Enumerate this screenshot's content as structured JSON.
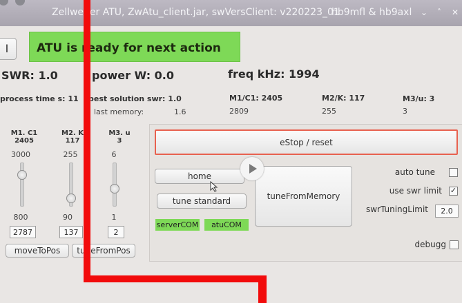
{
  "window": {
    "title": "Zellweger ATU, ZwAtu_client.jar,  swVersClient: v220223_01",
    "user": "hb9mfl & hb9axl",
    "controls": [
      "⌄",
      "˄",
      "✕"
    ]
  },
  "status_button": "I",
  "status_message": "ATU is ready for next action",
  "readouts": {
    "swr": "SWR: 1.0",
    "power": "power W: 0.0",
    "freq": "freq kHz: 1994"
  },
  "info": {
    "process_time": "process time s: 11",
    "best_solution": "best solution swr: 1.0",
    "m1c1": "M1/C1: 2405",
    "m2k": "M2/K: 117",
    "m3u": "M3/u: 3",
    "last_memory_label": "last memory:",
    "last_memory_swr": "1.6",
    "last_memory_m1": "2809",
    "last_memory_m2": "255",
    "last_memory_m3": "3"
  },
  "sliders": [
    {
      "label1": "M1. C1",
      "label2": "2405",
      "max": "3000",
      "min": "800",
      "input": "2787",
      "level": 0.73
    },
    {
      "label1": "M2. K",
      "label2": "117",
      "max": "255",
      "min": "90",
      "input": "137",
      "level": 0.17
    },
    {
      "label1": "M3. u",
      "label2": "3",
      "max": "6",
      "min": "1",
      "input": "2",
      "level": 0.4
    }
  ],
  "buttons": {
    "move_to_pos": "moveToPos",
    "tune_from_pos": "tuneFromPos",
    "estop": "eStop / reset",
    "home": "home",
    "tune_standard": "tune standard",
    "tune_from_memory": "tuneFromMemory"
  },
  "indicators": {
    "server_com": "serverCOM",
    "atu_com": "atuCOM"
  },
  "options": {
    "auto_tune": {
      "label": "auto tune",
      "checked": false
    },
    "use_swr_limit": {
      "label": "use swr limit",
      "checked": true
    },
    "swr_tuning_limit_label": "swrTuningLimit",
    "swr_tuning_limit_value": "2.0",
    "debugg": {
      "label": "debugg",
      "checked": false
    }
  },
  "colors": {
    "status_green": "#7ed957",
    "estop_border": "#e8614f",
    "overlay_red": "#f20b0b"
  }
}
